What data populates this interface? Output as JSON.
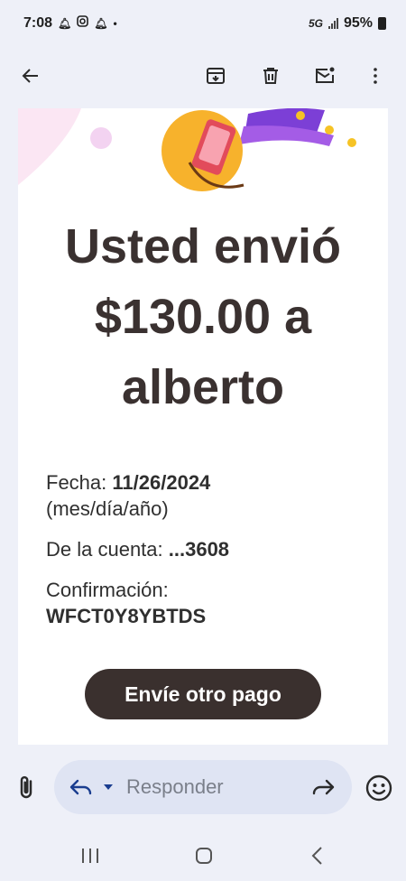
{
  "status_bar": {
    "time": "7:08",
    "network": "5G",
    "battery": "95%"
  },
  "app_bar": {
    "back_icon": "arrow-left-icon",
    "actions": [
      "archive-icon",
      "trash-icon",
      "mark-unread-icon",
      "more-vert-icon"
    ]
  },
  "email": {
    "headline_line1": "Usted envió",
    "headline_line2": "$130.00 a",
    "headline_line3": "alberto",
    "date_label": "Fecha:",
    "date_value": "11/26/2024",
    "date_format": "(mes/día/año)",
    "account_label": "De la cuenta:",
    "account_value": "...3608",
    "confirmation_label": "Confirmación:",
    "confirmation_value": "WFCT0Y8YBTDS",
    "cta_label": "Envíe otro pago"
  },
  "reply_bar": {
    "placeholder": "Responder"
  },
  "colors": {
    "headline": "#3a3130",
    "cta_bg": "#3a302e",
    "background": "#eef0f8",
    "reply_pill": "#dfe4f3"
  }
}
